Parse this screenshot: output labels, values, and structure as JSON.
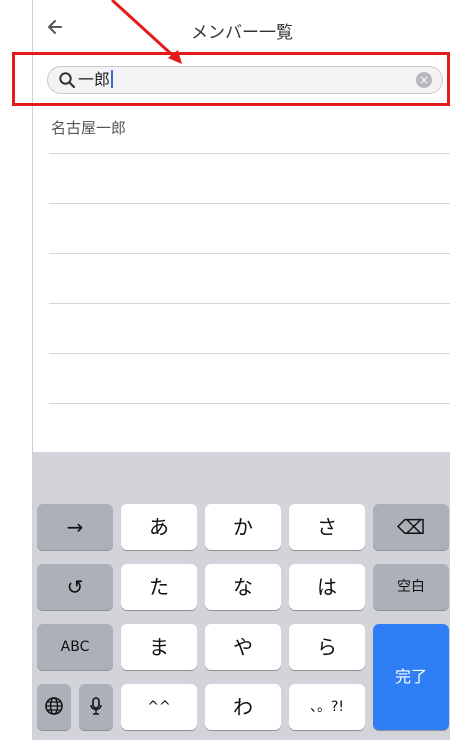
{
  "nav": {
    "title": "メンバー一覧",
    "back_icon": "arrow-left-icon"
  },
  "search": {
    "value": "一郎",
    "search_icon": "search-icon",
    "clear_icon": "clear-icon"
  },
  "list": {
    "items": [
      {
        "label": "名古屋一郎"
      },
      {
        "label": ""
      },
      {
        "label": ""
      },
      {
        "label": ""
      },
      {
        "label": ""
      },
      {
        "label": ""
      }
    ]
  },
  "keyboard": {
    "row1": [
      "→",
      "あ",
      "か",
      "さ",
      "⌫"
    ],
    "row2": [
      "↺",
      "た",
      "な",
      "は",
      "空白"
    ],
    "row3": [
      "ABC",
      "ま",
      "や",
      "ら"
    ],
    "row4": [
      "🌐",
      "🎙",
      "^^",
      "わ",
      "、。?!"
    ],
    "done": "完了"
  },
  "annotation": {
    "frame_color": "#e51b1b"
  }
}
